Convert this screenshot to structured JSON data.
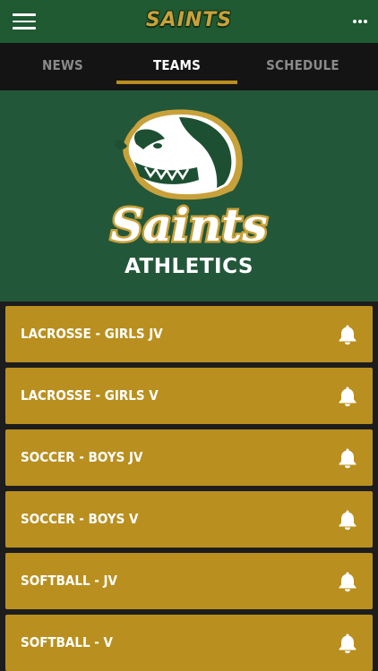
{
  "header": {
    "brand": "SAINTS",
    "menu_icon": "hamburger-menu-icon",
    "more_icon": "more-dots-icon"
  },
  "tabs": [
    {
      "label": "NEWS",
      "active": false
    },
    {
      "label": "TEAMS",
      "active": true
    },
    {
      "label": "SCHEDULE",
      "active": false
    }
  ],
  "hero": {
    "logo_text": "Saints",
    "subtitle": "ATHLETICS",
    "logo_icon": "saint-bernard-mascot-icon"
  },
  "teams": [
    {
      "label": "LACROSSE - GIRLS JV",
      "icon": "bell-icon"
    },
    {
      "label": "LACROSSE - GIRLS V",
      "icon": "bell-icon"
    },
    {
      "label": "SOCCER - BOYS JV",
      "icon": "bell-icon"
    },
    {
      "label": "SOCCER - BOYS V",
      "icon": "bell-icon"
    },
    {
      "label": "SOFTBALL - JV",
      "icon": "bell-icon"
    },
    {
      "label": "SOFTBALL - V",
      "icon": "bell-icon"
    }
  ],
  "colors": {
    "header_green": "#1f5a32",
    "hero_green": "#23573a",
    "gold": "#b98f1f",
    "tab_bg": "#141414"
  }
}
